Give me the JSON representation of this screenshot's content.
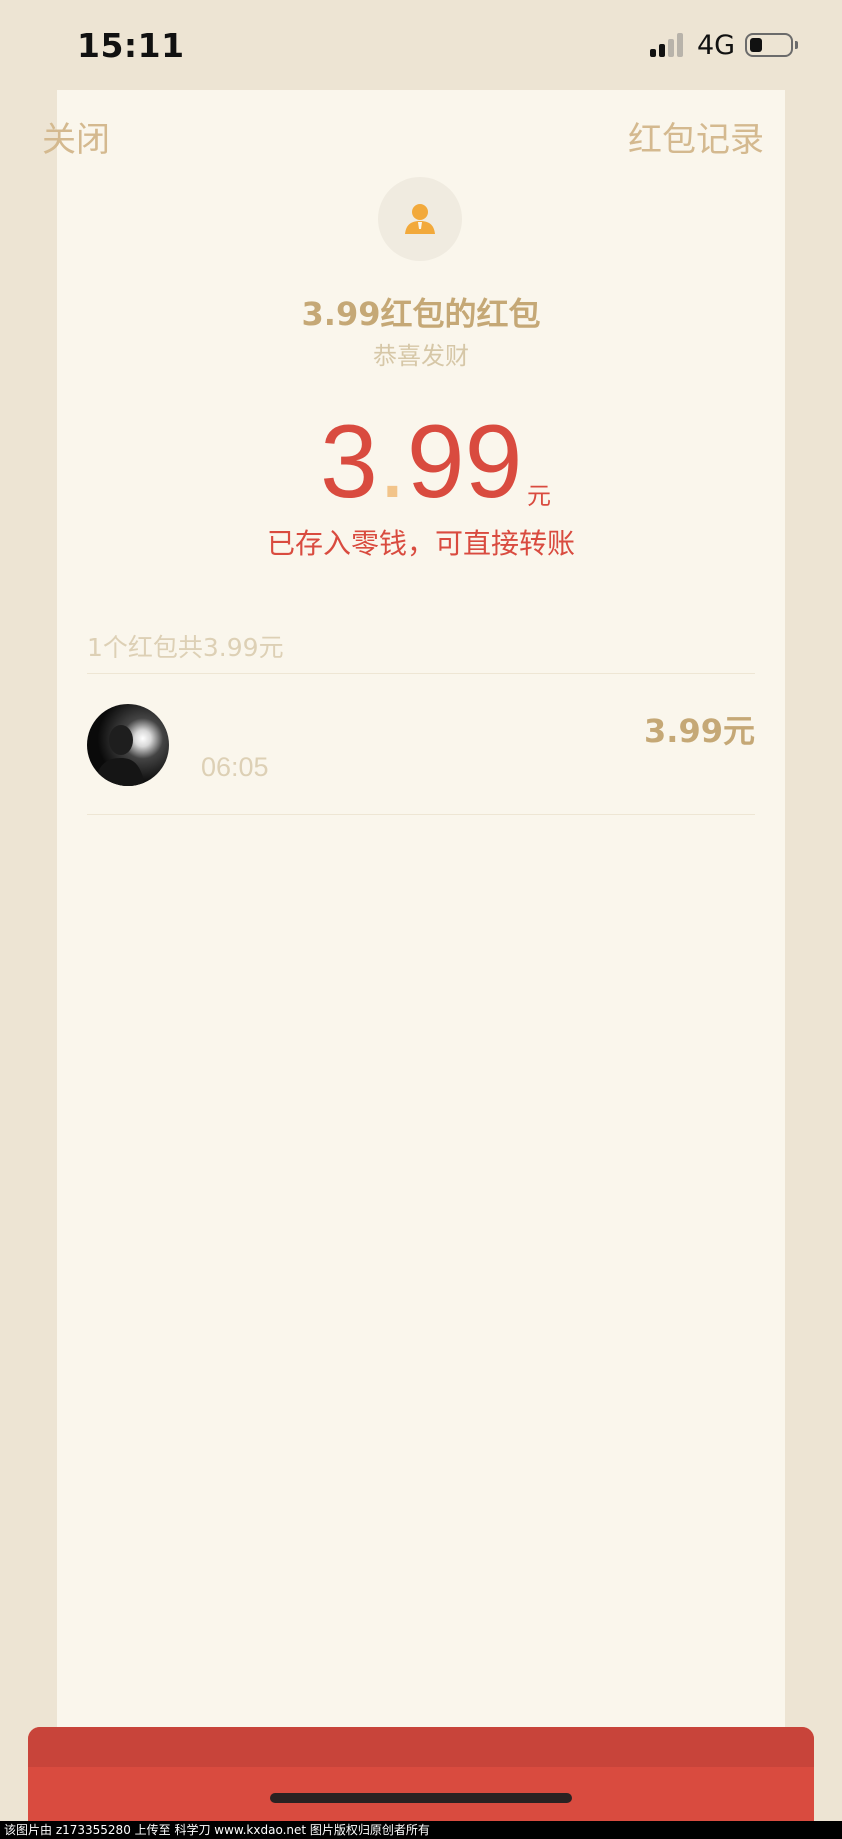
{
  "status_bar": {
    "time": "15:11",
    "network": "4G",
    "icons": [
      "signal-icon",
      "battery-icon"
    ]
  },
  "nav": {
    "close_label": "关闭",
    "records_label": "红包记录"
  },
  "sender": {
    "avatar_icon": "person-icon",
    "title": "3.99红包的红包",
    "wish": "恭喜发财"
  },
  "amount": {
    "integer": "3",
    "dot": ".",
    "decimal": "99",
    "unit": "元",
    "saved_text": "已存入零钱，可直接转账"
  },
  "summary": "1个红包共3.99元",
  "receivers": [
    {
      "amount": "3.99元",
      "time": "06:05"
    }
  ],
  "colors": {
    "accent_red": "#d94b3f",
    "gold": "#c5a876",
    "card_bg": "#faf6ec",
    "page_bg": "#ede4d3"
  },
  "watermark": "该图片由 z173355280 上传至 科学刀 www.kxdao.net 图片版权归原创者所有"
}
